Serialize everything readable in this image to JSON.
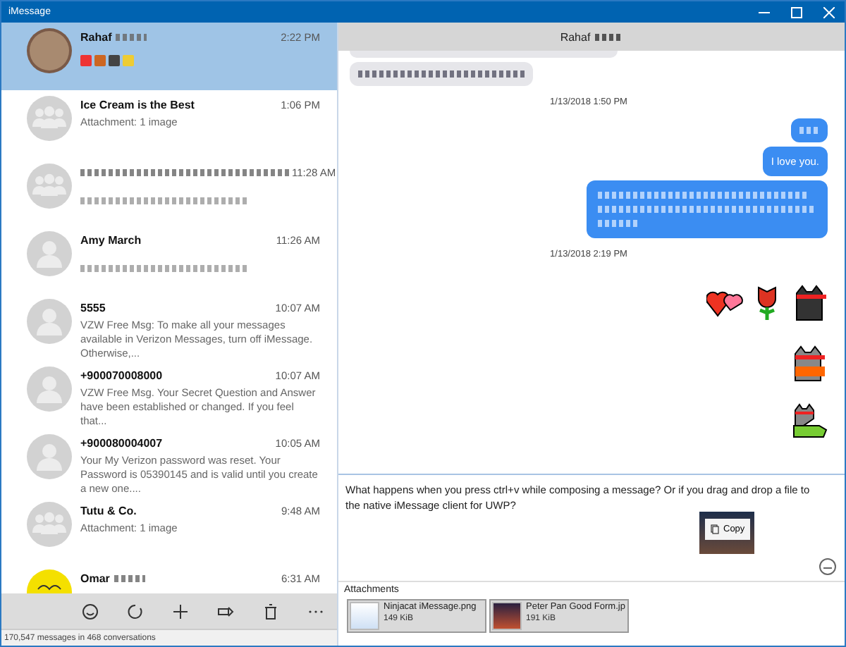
{
  "window": {
    "title": "iMessage"
  },
  "conversations": [
    {
      "name": "Rahaf",
      "name_redacted": true,
      "time": "2:22 PM",
      "preview": {
        "kind": "stickers"
      },
      "avatar": {
        "kind": "photo"
      },
      "selected": true
    },
    {
      "name": "Ice Cream is the Best",
      "name_redacted": false,
      "time": "1:06 PM",
      "preview": {
        "kind": "text",
        "text": "Attachment: 1 image"
      },
      "avatar": {
        "kind": "group"
      },
      "selected": false
    },
    {
      "name_redacted": true,
      "time": "11:28 AM",
      "preview": {
        "kind": "redacted"
      },
      "avatar": {
        "kind": "group"
      },
      "selected": false
    },
    {
      "name": "Amy March",
      "name_redacted": false,
      "time": "11:26 AM",
      "preview": {
        "kind": "redacted"
      },
      "avatar": {
        "kind": "person"
      },
      "selected": false
    },
    {
      "name": "5555",
      "name_redacted": false,
      "time": "10:07 AM",
      "preview": {
        "kind": "text",
        "text": "VZW Free Msg: To make all your messages available in Verizon Messages, turn off iMessage. Otherwise,..."
      },
      "avatar": {
        "kind": "person"
      },
      "selected": false
    },
    {
      "name": "+900070008000",
      "name_redacted": false,
      "time": "10:07 AM",
      "preview": {
        "kind": "text",
        "text": "VZW Free Msg. Your Secret Question and Answer have been established or changed. If you feel that..."
      },
      "avatar": {
        "kind": "person"
      },
      "selected": false
    },
    {
      "name": "+900080004007",
      "name_redacted": false,
      "time": "10:05 AM",
      "preview": {
        "kind": "text",
        "text": "Your My Verizon password was reset. Your Password is 05390145 and is valid until you create a new one...."
      },
      "avatar": {
        "kind": "person"
      },
      "selected": false
    },
    {
      "name": "Tutu & Co.",
      "name_redacted": false,
      "time": "9:48 AM",
      "preview": {
        "kind": "text",
        "text": "Attachment: 1 image"
      },
      "avatar": {
        "kind": "group"
      },
      "selected": false
    },
    {
      "name": "Omar",
      "name_redacted": true,
      "time": "6:31 AM",
      "avatar": {
        "kind": "smiley"
      },
      "selected": false
    }
  ],
  "toolbar": [
    {
      "kind": "smiley"
    },
    {
      "kind": "refresh"
    },
    {
      "kind": "add"
    },
    {
      "kind": "attach"
    },
    {
      "kind": "delete"
    },
    {
      "kind": "more"
    }
  ],
  "status_bar": "170,547 messages in 468 conversations",
  "chat": {
    "title": "Rahaf",
    "title_redacted": true,
    "messages": [
      {
        "kind": "redacted_bubble",
        "outgoing": false
      },
      {
        "kind": "date",
        "text": "1/13/2018 1:50 PM"
      },
      {
        "kind": "redacted_bubble",
        "outgoing": true
      },
      {
        "kind": "text_bubble",
        "outgoing": true,
        "text": "I love you."
      },
      {
        "kind": "redacted_paragraph",
        "outgoing": true
      },
      {
        "kind": "date",
        "text": "1/13/2018 2:19 PM"
      },
      {
        "kind": "stickers",
        "stickers": [
          {
            "kind": "heart"
          },
          {
            "kind": "rose"
          },
          {
            "kind": "ninjacat"
          }
        ]
      },
      {
        "kind": "stickers",
        "stickers": [
          {
            "kind": "foxcat"
          }
        ]
      },
      {
        "kind": "stickers",
        "stickers": [
          {
            "kind": "dinocat"
          }
        ]
      }
    ]
  },
  "compose": {
    "value": "What happens when you press ctrl+v while composing a message? Or if you drag and drop a file to the native iMessage client for UWP?",
    "menu_item": "Copy"
  },
  "attachments": {
    "label": "Attachments",
    "items": [
      {
        "name": "Ninjacat iMessage.png",
        "size": "149 KiB",
        "thumb": {
          "kind": "screenshot"
        }
      },
      {
        "name": "Peter Pan Good Form.jp",
        "size": "191 KiB",
        "thumb": {
          "kind": "photo"
        }
      }
    ]
  }
}
